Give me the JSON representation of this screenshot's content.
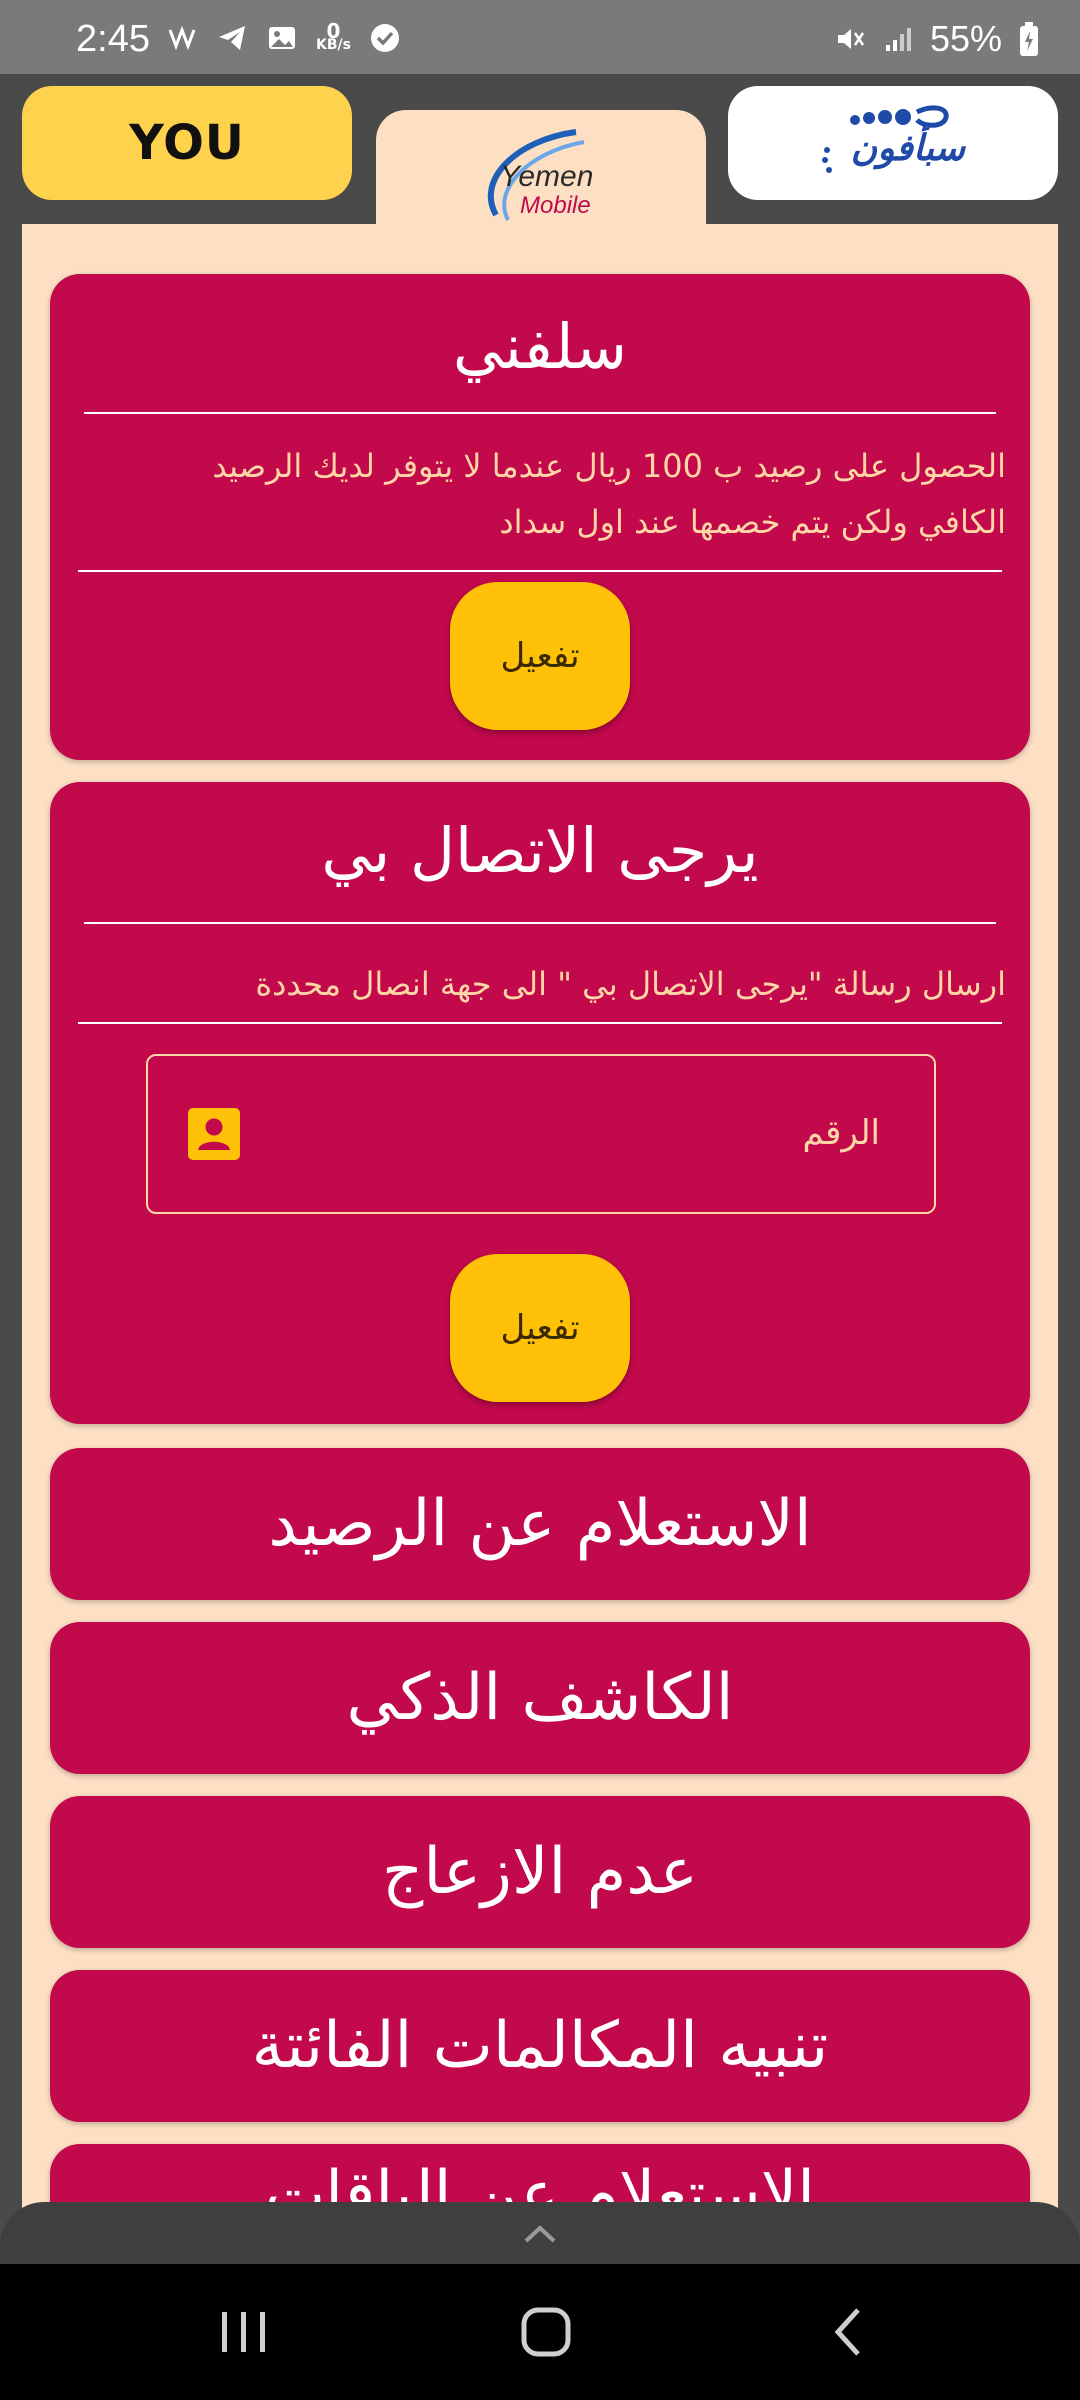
{
  "status_bar": {
    "time": "2:45",
    "kbs_value": "0",
    "kbs_unit": "KB/s",
    "battery": "55%"
  },
  "tabs": {
    "you_label": "YOU",
    "yemen_mobile": {
      "line1": "Yemen",
      "line2": "Mobile"
    },
    "sabafon": "سبأفون"
  },
  "cards": {
    "salifni": {
      "title": "سلفني",
      "description_line1": "الحصول على رصيد ب 100 ريال عندما لا يتوفر لديك الرصيد",
      "description_line2": "الكافي ولكن يتم خصمها عند اول سداد",
      "button": "تفعيل"
    },
    "call_me": {
      "title": "يرجى الاتصال بي",
      "description": "ارسال رسالة \"يرجى الاتصال بي \" الى جهة انصال محددة",
      "input_placeholder": "الرقم",
      "button": "تفعيل"
    }
  },
  "menu": [
    {
      "label": "الاستعلام عن الرصيد"
    },
    {
      "label": "الكاشف الذكي"
    },
    {
      "label": "عدم الازعاج"
    },
    {
      "label": "تنبيه المكالمات الفائتة"
    },
    {
      "label": "الاستعلام عن الباقات"
    }
  ],
  "colors": {
    "card": "#c1094b",
    "button": "#ffc107",
    "background": "#fde0c4",
    "you_tab": "#ffd24d"
  },
  "icons": {
    "contact": "contact-icon",
    "expand": "chevron-up-icon",
    "nav_recents": "recents-icon",
    "nav_home": "home-icon",
    "nav_back": "back-icon"
  }
}
